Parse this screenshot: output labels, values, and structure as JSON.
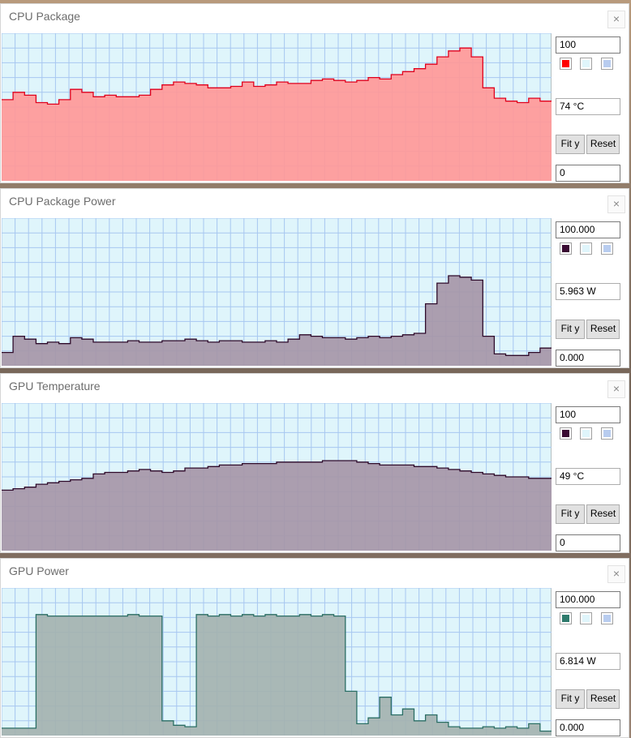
{
  "colors": {
    "grid_bg": "#dff5fb",
    "grid_line": "#a7c7f0",
    "panel_bg": "#ffffff"
  },
  "close_label": "×",
  "panels": [
    {
      "title": "CPU Package",
      "max": "100",
      "value": "74 °C",
      "min": "0",
      "fit_label": "Fit y",
      "reset_label": "Reset",
      "color": "#ff0000",
      "line_color": "#e0001c",
      "fill_color": "#ff9898",
      "swatch2": "#dff5fb",
      "swatch3": "#b8ccef",
      "chart_data": {
        "type": "area",
        "ylim": [
          0,
          100
        ],
        "x_samples": 48,
        "values": [
          55,
          60,
          58,
          53,
          52,
          55,
          62,
          60,
          57,
          58,
          57,
          57,
          58,
          62,
          65,
          67,
          66,
          65,
          63,
          63,
          64,
          67,
          64,
          65,
          67,
          66,
          66,
          68,
          69,
          68,
          67,
          68,
          70,
          69,
          72,
          74,
          76,
          79,
          84,
          88,
          90,
          84,
          63,
          56,
          54,
          53,
          56,
          54
        ]
      }
    },
    {
      "title": "CPU Package Power",
      "max": "100.000",
      "value": "5.963 W",
      "min": "0.000",
      "fit_label": "Fit y",
      "reset_label": "Reset",
      "color": "#3a0a33",
      "line_color": "#2e0a2a",
      "fill_color": "#a696a8",
      "swatch2": "#dff5fb",
      "swatch3": "#b8ccef",
      "chart_data": {
        "type": "area",
        "ylim": [
          0,
          100
        ],
        "x_samples": 48,
        "values": [
          9,
          20,
          18,
          15,
          16,
          15,
          19,
          18,
          16,
          16,
          16,
          17,
          16,
          16,
          17,
          17,
          18,
          17,
          16,
          17,
          17,
          16,
          16,
          17,
          16,
          18,
          21,
          20,
          19,
          19,
          18,
          19,
          20,
          19,
          20,
          21,
          22,
          42,
          56,
          61,
          60,
          58,
          20,
          8,
          7,
          7,
          9,
          12
        ]
      }
    },
    {
      "title": "GPU Temperature",
      "max": "100",
      "value": "49 °C",
      "min": "0",
      "fit_label": "Fit y",
      "reset_label": "Reset",
      "color": "#3a0a33",
      "line_color": "#2e0a2a",
      "fill_color": "#a696a8",
      "swatch2": "#dff5fb",
      "swatch3": "#b8ccef",
      "chart_data": {
        "type": "area",
        "ylim": [
          0,
          100
        ],
        "x_samples": 48,
        "values": [
          41,
          42,
          43,
          45,
          46,
          47,
          48,
          49,
          52,
          53,
          53,
          54,
          55,
          54,
          53,
          54,
          56,
          56,
          57,
          58,
          58,
          59,
          59,
          59,
          60,
          60,
          60,
          60,
          61,
          61,
          61,
          60,
          59,
          58,
          58,
          58,
          57,
          57,
          56,
          55,
          54,
          53,
          52,
          51,
          50,
          50,
          49,
          49
        ]
      }
    },
    {
      "title": "GPU Power",
      "max": "100.000",
      "value": "6.814 W",
      "min": "0.000",
      "fit_label": "Fit y",
      "reset_label": "Reset",
      "color": "#2e7a6c",
      "line_color": "#2b6e64",
      "fill_color": "#a4b2b0",
      "swatch2": "#dff5fb",
      "swatch3": "#b8ccef",
      "chart_data": {
        "type": "area",
        "ylim": [
          0,
          100
        ],
        "x_samples": 48,
        "values": [
          5,
          5,
          5,
          82,
          81,
          81,
          81,
          81,
          81,
          81,
          81,
          82,
          81,
          81,
          10,
          7,
          6,
          82,
          81,
          82,
          81,
          82,
          81,
          82,
          81,
          81,
          82,
          81,
          82,
          81,
          30,
          8,
          12,
          26,
          14,
          18,
          10,
          14,
          9,
          6,
          5,
          5,
          6,
          5,
          6,
          5,
          8,
          3
        ]
      }
    }
  ]
}
